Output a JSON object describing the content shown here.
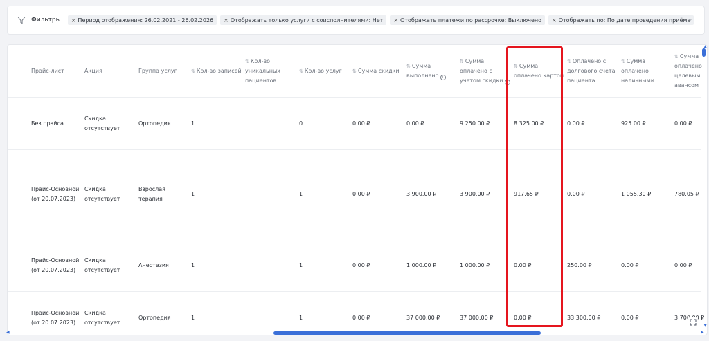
{
  "filters": {
    "label": "Фильтры",
    "chips": [
      "Период отображения: 26.02.2021 - 26.02.2026",
      "Отображать только услуги с соисполнителями: Нет",
      "Отображать платежи по рассрочке: Выключено",
      "Отображать по: По дате проведения приёма"
    ],
    "remove_glyph": "×",
    "toggle_glyph": "⌄"
  },
  "table": {
    "headers": [
      "Прайс-лист",
      "Акция",
      "Группа услуг",
      "Кол-во записей",
      "Кол-во уникальных пациентов",
      "Кол-во услуг",
      "Сумма скидки",
      "Сумма выполнено",
      "Сумма оплачено с учетом скидки",
      "Сумма оплачено картой",
      "Оплачено с долгового счета пациента",
      "Сумма оплачено наличными",
      "Сумма оплачено целевым авансом"
    ],
    "sort_glyph": "⇅",
    "info_glyph": "i",
    "rows": [
      [
        "Без прайса",
        "Скидка отсутствует",
        "Ортопедия",
        "1",
        "",
        "0",
        "0.00 ₽",
        "0.00 ₽",
        "9 250.00 ₽",
        "8 325.00 ₽",
        "0.00 ₽",
        "925.00 ₽",
        "0.00 ₽"
      ],
      [
        "Прайс-Основной (от 20.07.2023)",
        "Скидка отсутствует",
        "Взрослая терапия",
        "1",
        "",
        "1",
        "0.00 ₽",
        "3 900.00 ₽",
        "3 900.00 ₽",
        "917.65 ₽",
        "0.00 ₽",
        "1 055.30 ₽",
        "780.05 ₽"
      ],
      [
        "Прайс-Основной (от 20.07.2023)",
        "Скидка отсутствует",
        "Анестезия",
        "1",
        "",
        "1",
        "0.00 ₽",
        "1 000.00 ₽",
        "1 000.00 ₽",
        "0.00 ₽",
        "250.00 ₽",
        "0.00 ₽",
        "0.00 ₽"
      ],
      [
        "Прайс-Основной (от 20.07.2023)",
        "Скидка отсутствует",
        "Ортопедия",
        "1",
        "",
        "1",
        "0.00 ₽",
        "37 000.00 ₽",
        "37 000.00 ₽",
        "0.00 ₽",
        "33 300.00 ₽",
        "0.00 ₽",
        "3 700.00 ₽"
      ]
    ]
  },
  "scroll": {
    "up_glyph": "▲",
    "down_glyph": "▼",
    "left_glyph": "◀",
    "right_glyph": "▶"
  },
  "colors": {
    "accent": "#3a6fd8",
    "highlight": "#e5151e"
  }
}
